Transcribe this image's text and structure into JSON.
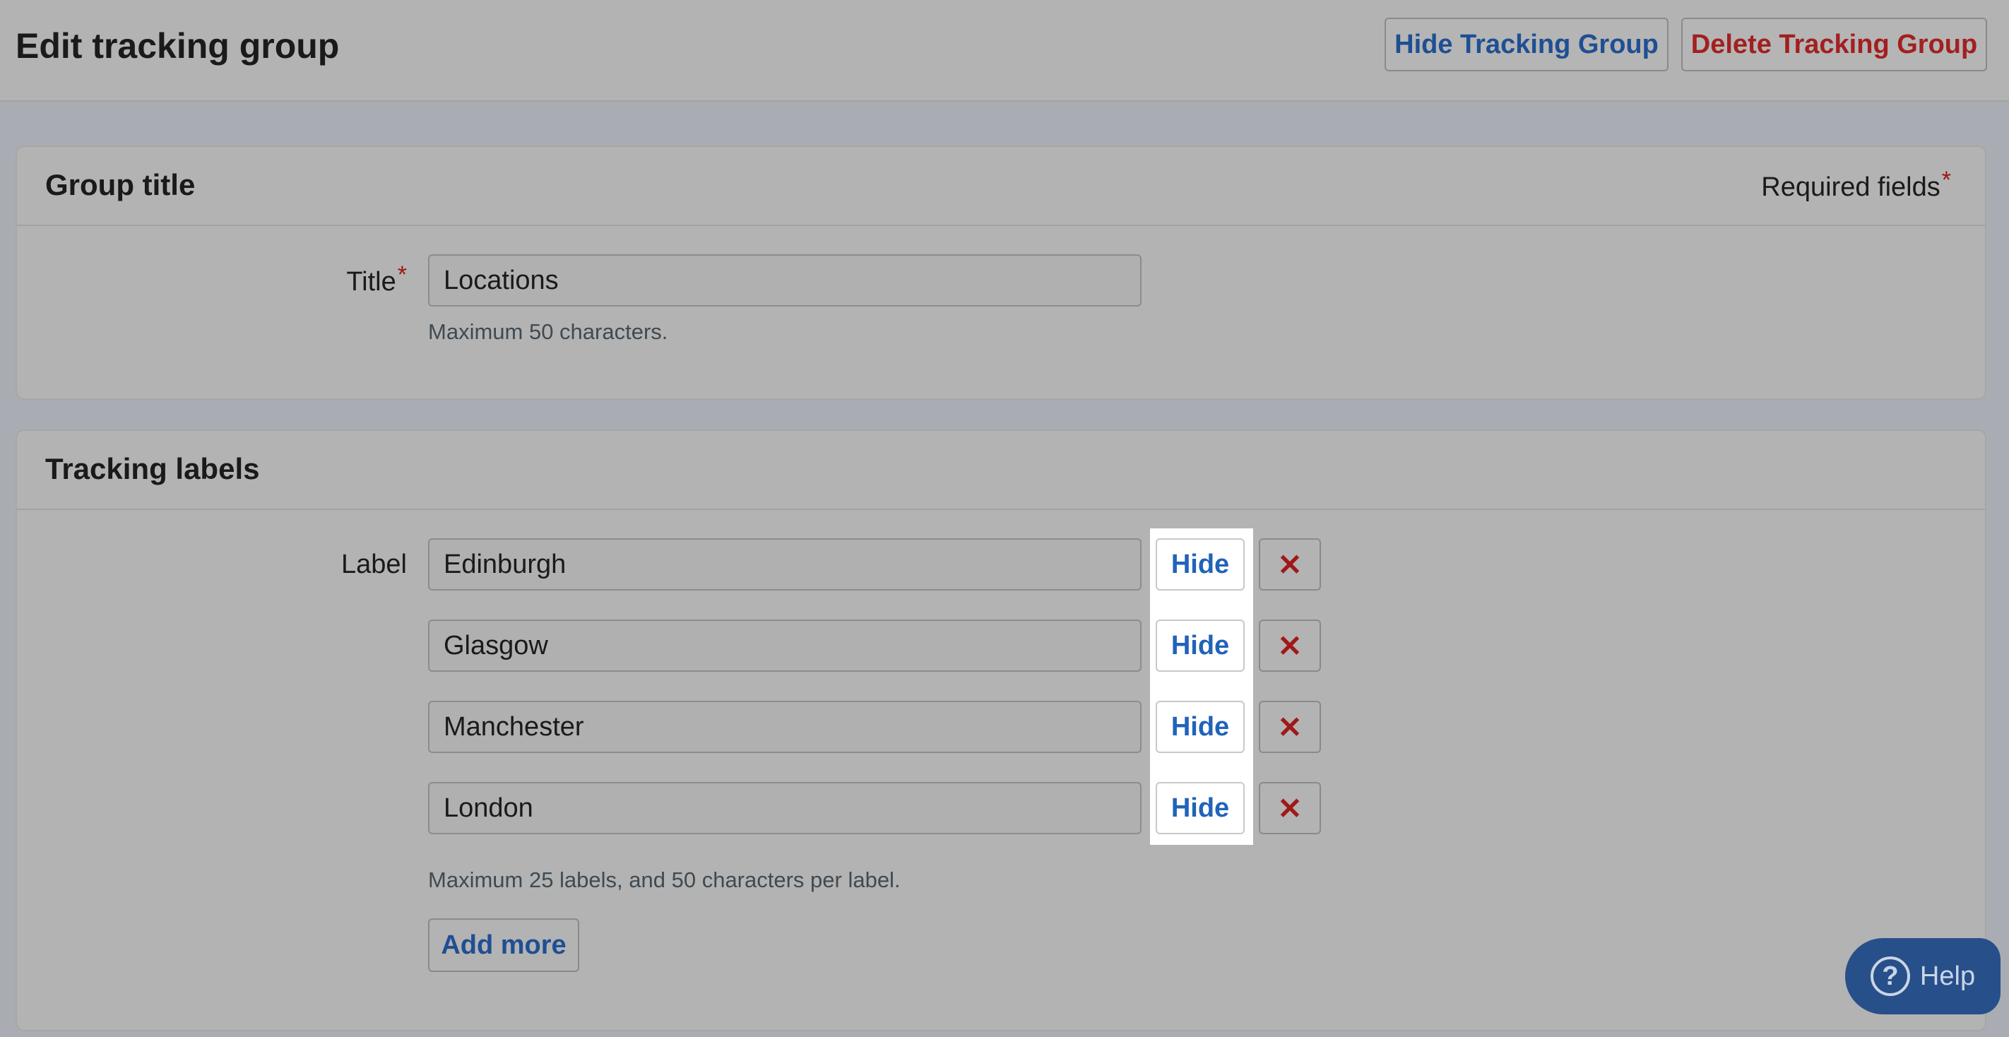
{
  "header": {
    "title": "Edit tracking group",
    "hide_group_label": "Hide Tracking Group",
    "delete_group_label": "Delete Tracking Group"
  },
  "group_panel": {
    "heading": "Group title",
    "required_note": "Required fields",
    "required_marker": "*",
    "title_field": {
      "label": "Title",
      "required_marker": "*",
      "value": "Locations",
      "hint": "Maximum 50 characters."
    }
  },
  "labels_panel": {
    "heading": "Tracking labels",
    "field_label": "Label",
    "labels": [
      {
        "value": "Edinburgh",
        "hide_label": "Hide",
        "remove_symbol": "✕"
      },
      {
        "value": "Glasgow",
        "hide_label": "Hide",
        "remove_symbol": "✕"
      },
      {
        "value": "Manchester",
        "hide_label": "Hide",
        "remove_symbol": "✕"
      },
      {
        "value": "London",
        "hide_label": "Hide",
        "remove_symbol": "✕"
      }
    ],
    "hint": "Maximum 25 labels, and 50 characters per label.",
    "add_more_label": "Add more"
  },
  "help": {
    "label": "Help",
    "icon_symbol": "?",
    "icon": "question-circle-icon"
  },
  "colors": {
    "link_blue": "#1f4f93",
    "danger_red": "#a31f1f",
    "help_bg": "#274f8a"
  }
}
